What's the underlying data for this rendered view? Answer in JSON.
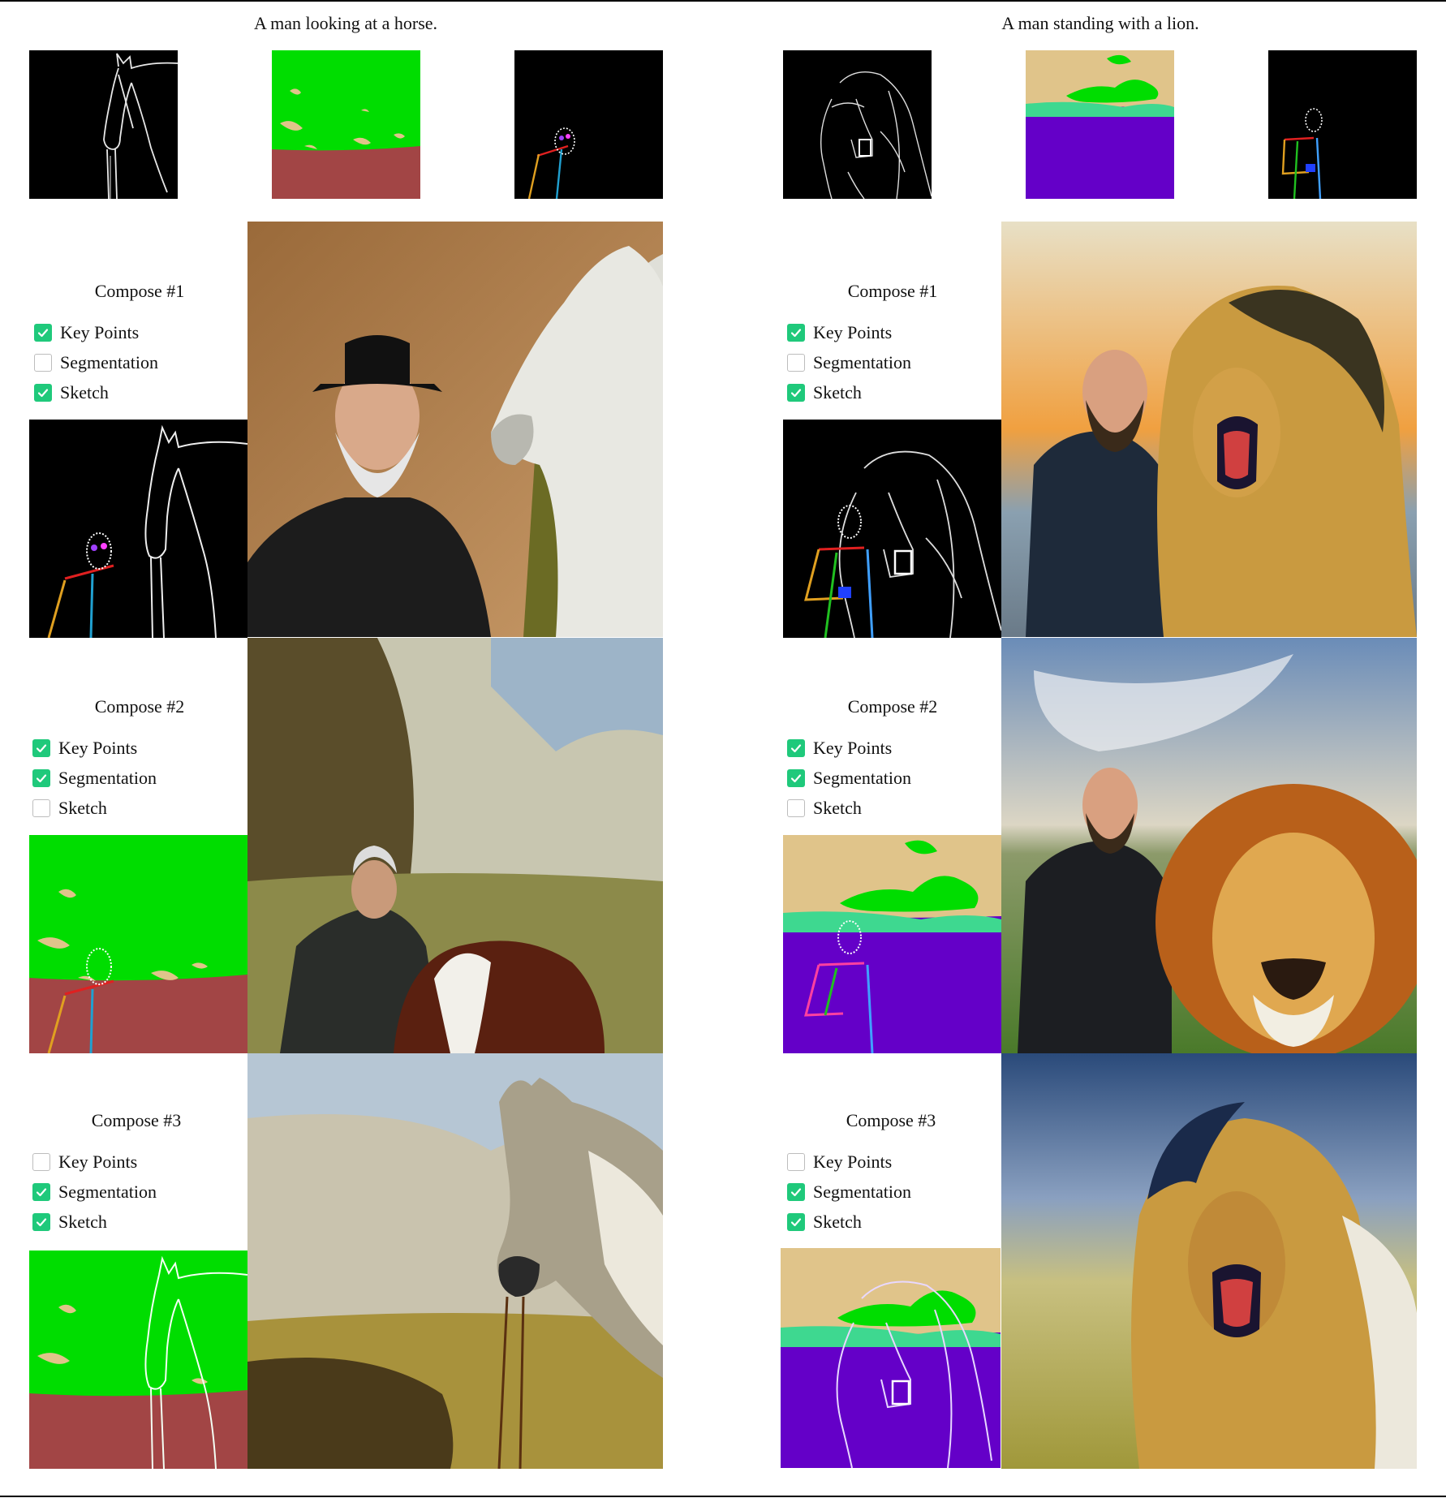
{
  "columns": [
    {
      "caption": "A man looking at a horse.",
      "inputs": [
        {
          "kind": "sketch",
          "name": "horse-sketch-input"
        },
        {
          "kind": "segmentation",
          "name": "horse-segmentation-input"
        },
        {
          "kind": "keypoints",
          "name": "horse-keypoints-input"
        }
      ],
      "rows": [
        {
          "title": "Compose #1",
          "options": [
            {
              "label": "Key Points",
              "checked": true
            },
            {
              "label": "Segmentation",
              "checked": false
            },
            {
              "label": "Sketch",
              "checked": true
            }
          ],
          "result": "Painting of a bearded man in a black hat beside a white horse"
        },
        {
          "title": "Compose #2",
          "options": [
            {
              "label": "Key Points",
              "checked": true
            },
            {
              "label": "Segmentation",
              "checked": true
            },
            {
              "label": "Sketch",
              "checked": false
            }
          ],
          "result": "Painting of a man kneeling beside a brown and white horse in a field"
        },
        {
          "title": "Compose #3",
          "options": [
            {
              "label": "Key Points",
              "checked": false
            },
            {
              "label": "Segmentation",
              "checked": true
            },
            {
              "label": "Sketch",
              "checked": true
            }
          ],
          "result": "Painting of a grey horse with a bridle in a grassy landscape"
        }
      ]
    },
    {
      "caption": "A man standing with a lion.",
      "inputs": [
        {
          "kind": "sketch",
          "name": "lion-sketch-input"
        },
        {
          "kind": "segmentation",
          "name": "lion-segmentation-input"
        },
        {
          "kind": "keypoints",
          "name": "lion-keypoints-input"
        }
      ],
      "rows": [
        {
          "title": "Compose #1",
          "options": [
            {
              "label": "Key Points",
              "checked": true
            },
            {
              "label": "Segmentation",
              "checked": false
            },
            {
              "label": "Sketch",
              "checked": true
            }
          ],
          "result": "Photo of a bald bearded man next to a roaring lion at sunset"
        },
        {
          "title": "Compose #2",
          "options": [
            {
              "label": "Key Points",
              "checked": true
            },
            {
              "label": "Segmentation",
              "checked": true
            },
            {
              "label": "Sketch",
              "checked": false
            }
          ],
          "result": "Photo of a bald man next to a lion in a green field under a cloudy sky"
        },
        {
          "title": "Compose #3",
          "options": [
            {
              "label": "Key Points",
              "checked": false
            },
            {
              "label": "Segmentation",
              "checked": true
            },
            {
              "label": "Sketch",
              "checked": true
            }
          ],
          "result": "Photo of a roaring lion with a blurred savanna background"
        }
      ]
    }
  ],
  "colors": {
    "check_on": "#1fc97b",
    "seg_green": "#00dd00",
    "seg_tan": "#e0c48a",
    "seg_brown": "#a24545",
    "seg_purple": "#6400c8",
    "seg_teal": "#3ed890"
  }
}
